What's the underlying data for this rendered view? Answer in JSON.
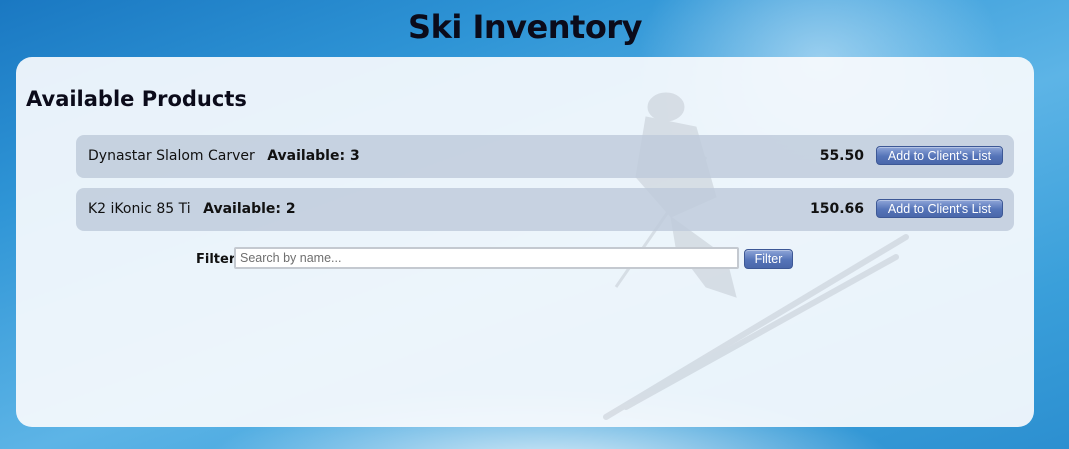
{
  "header": {
    "title": "Ski Inventory"
  },
  "main": {
    "section_title": "Available Products",
    "products": [
      {
        "name": "Dynastar Slalom Carver",
        "availability": "Available: 3",
        "price": "55.50",
        "action_label": "Add to Client's List"
      },
      {
        "name": "K2 iKonic 85 Ti",
        "availability": "Available: 2",
        "price": "150.66",
        "action_label": "Add to Client's List"
      }
    ],
    "filter": {
      "label": "Filter",
      "value": "",
      "placeholder": "Search by name...",
      "button_label": "Filter"
    }
  },
  "background": {
    "image": "skier-photo",
    "colors": {
      "sky": "#3a9fda",
      "panel": "#f7fafd",
      "row": "#becbda",
      "button": "#5574b8"
    }
  }
}
